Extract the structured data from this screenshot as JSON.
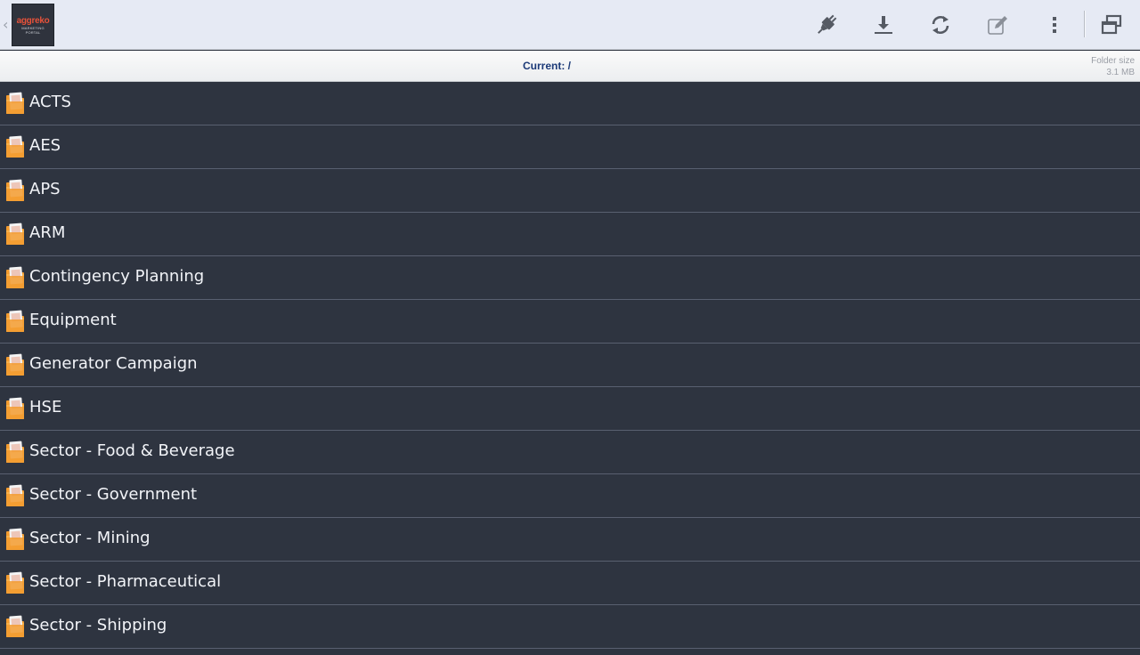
{
  "app": {
    "logo_brand": "aggreko",
    "logo_sub_1": "MARKETING",
    "logo_sub_2": "PORTAL"
  },
  "toolbar": {
    "icons": [
      "plug-icon",
      "download-icon",
      "refresh-icon",
      "edit-icon",
      "overflow-menu-icon",
      "window-icon"
    ]
  },
  "pathbar": {
    "current": "Current: /",
    "size_label": "Folder size",
    "size_value": "3.1 MB"
  },
  "folders": [
    {
      "label": "ACTS"
    },
    {
      "label": "AES"
    },
    {
      "label": "APS"
    },
    {
      "label": "ARM"
    },
    {
      "label": "Contingency Planning"
    },
    {
      "label": "Equipment"
    },
    {
      "label": "Generator Campaign"
    },
    {
      "label": "HSE"
    },
    {
      "label": "Sector - Food & Beverage"
    },
    {
      "label": "Sector - Government"
    },
    {
      "label": "Sector - Mining"
    },
    {
      "label": "Sector - Pharmaceutical"
    },
    {
      "label": "Sector - Shipping"
    }
  ],
  "colors": {
    "actionbar": "#e6eaf4",
    "list_bg": "#2e3440",
    "path_text": "#1c3a78",
    "folder_orange": "#f39b2e"
  }
}
